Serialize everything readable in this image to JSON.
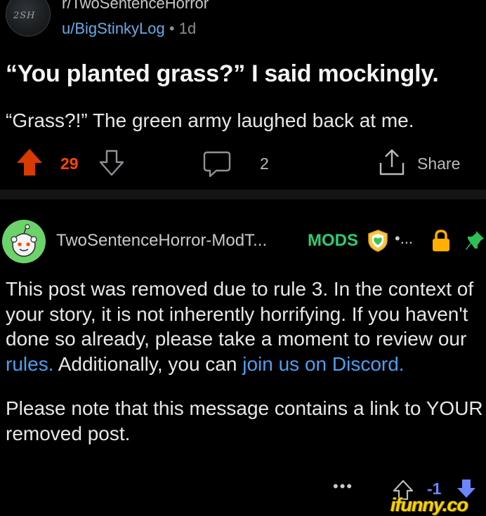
{
  "post": {
    "subreddit": "r/TwoSentenceHorror",
    "subreddit_avatar_text": "2SH",
    "author": "u/BigStinkyLog",
    "separator": "•",
    "age": "1d",
    "title": "“You planted grass?” I said mockingly.",
    "body": "“Grass?!” The green army laughed back at me.",
    "score": "29",
    "comment_count": "2",
    "share_label": "Share",
    "vote_state": "upvoted"
  },
  "comment": {
    "author": "TwoSentenceHorror-ModT...",
    "badge": "MODS",
    "more": "•...",
    "paragraph1_parts": {
      "a": "This post was removed due to rule 3. In the context of your story, it is not inherently horrifying. If you haven't done so already, please take a moment to review our ",
      "link1": "rules.",
      "b": " Additionally, you can ",
      "link2": "join us on Discord."
    },
    "paragraph2": "Please note that this message contains a link to YOUR removed post.",
    "actions_more": "•••",
    "score": "-1",
    "vote_state": "downvoted"
  },
  "watermark": "ifunny.co",
  "colors": {
    "background": "#000000",
    "upvote": "#ff4500",
    "downvote": "#6b86ff",
    "link": "#4d9ff0",
    "mods_badge": "#2ecc71",
    "watermark": "#f5d300"
  },
  "icons": [
    "upvote-icon",
    "downvote-icon",
    "comment-icon",
    "share-icon",
    "shield-icon",
    "lock-icon",
    "pin-icon"
  ]
}
